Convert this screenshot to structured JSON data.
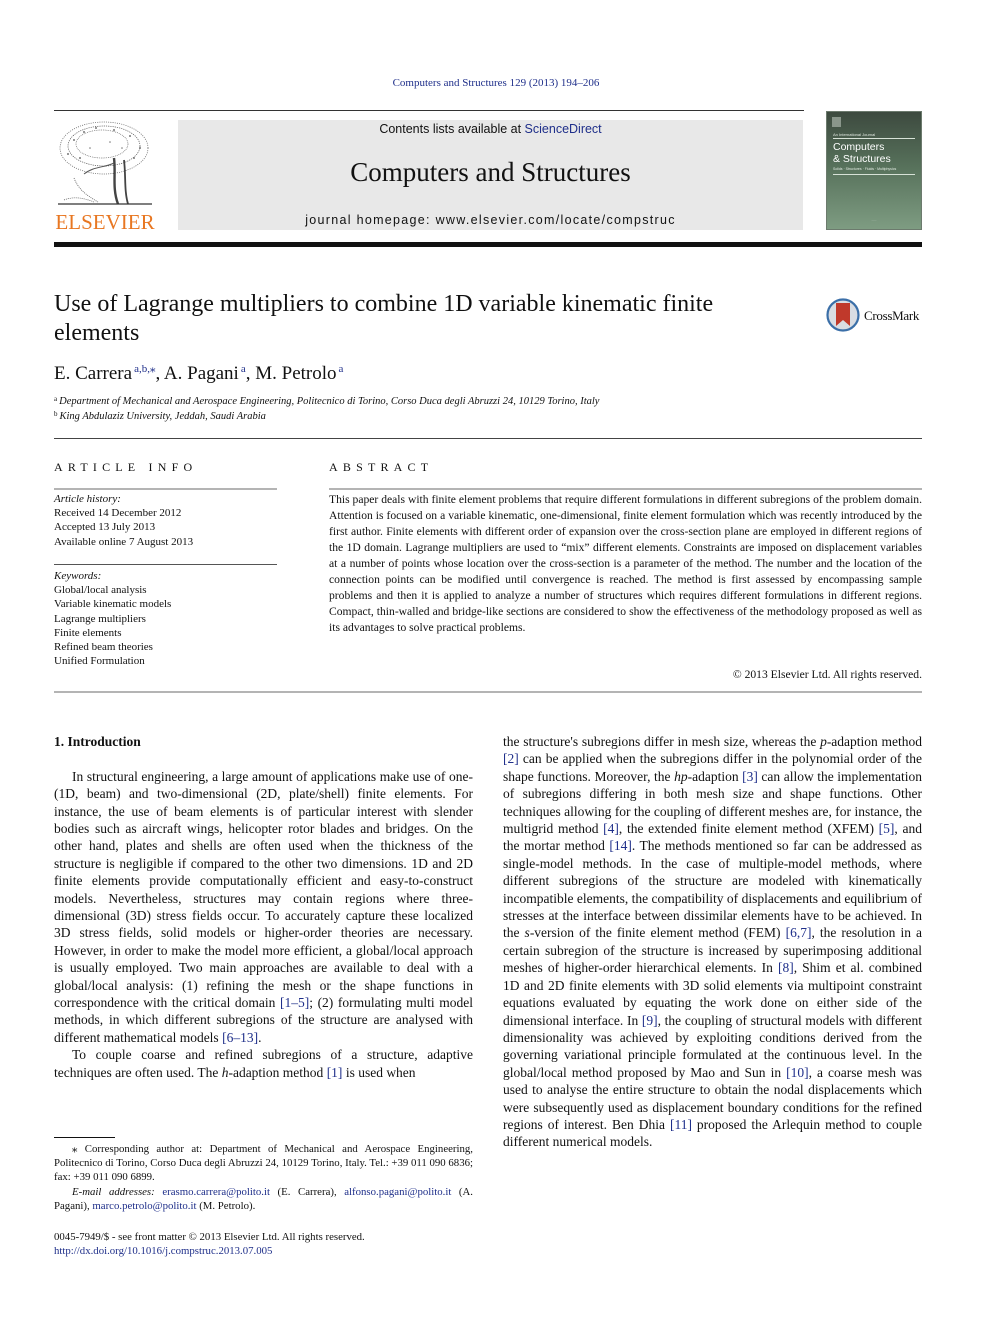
{
  "running_head": "Computers and Structures 129 (2013) 194–206",
  "publisher": {
    "name": "ELSEVIER",
    "brand_color": "#e87722"
  },
  "banner": {
    "contents_prefix": "Contents lists available at ",
    "contents_link": "ScienceDirect",
    "journal_title": "Computers and Structures",
    "homepage": "journal homepage: www.elsevier.com/locate/compstruc"
  },
  "cover": {
    "kicker": "An International Journal",
    "title_line1": "Computers",
    "title_line2": "& Structures",
    "subtitle": "Solids · Structures · Fluids · Multiphysics"
  },
  "article": {
    "title": "Use of Lagrange multipliers to combine 1D variable kinematic finite elements",
    "crossmark_label": "CrossMark",
    "authors": [
      {
        "name": "E. Carrera",
        "sup": "a,b,⁎",
        "sep": ", "
      },
      {
        "name": "A. Pagani",
        "sup": "a",
        "sep": ", "
      },
      {
        "name": "M. Petrolo",
        "sup": "a",
        "sep": ""
      }
    ],
    "affiliations": [
      {
        "mark": "a",
        "text": "Department of Mechanical and Aerospace Engineering, Politecnico di Torino, Corso Duca degli Abruzzi 24, 10129 Torino, Italy"
      },
      {
        "mark": "b",
        "text": "King Abdulaziz University, Jeddah, Saudi Arabia"
      }
    ]
  },
  "article_info": {
    "heading": "ARTICLE INFO",
    "history_label": "Article history:",
    "history": [
      "Received 14 December 2012",
      "Accepted 13 July 2013",
      "Available online 7 August 2013"
    ],
    "keywords_label": "Keywords:",
    "keywords": [
      "Global/local analysis",
      "Variable kinematic models",
      "Lagrange multipliers",
      "Finite elements",
      "Refined beam theories",
      "Unified Formulation"
    ]
  },
  "abstract": {
    "heading": "ABSTRACT",
    "text": "This paper deals with finite element problems that require different formulations in different subregions of the problem domain. Attention is focused on a variable kinematic, one-dimensional, finite element formulation which was recently introduced by the first author. Finite elements with different order of expansion over the cross-section plane are employed in different regions of the 1D domain. Lagrange multipliers are used to “mix” different elements. Constraints are imposed on displacement variables at a number of points whose location over the cross-section is a parameter of the method. The number and the location of the connection points can be modified until convergence is reached. The method is first assessed by encompassing sample problems and then it is applied to analyze a number of structures which requires different formulations in different regions. Compact, thin-walled and bridge-like sections are considered to show the effectiveness of the methodology proposed as well as its advantages to solve practical problems.",
    "copyright": "© 2013 Elsevier Ltd. All rights reserved."
  },
  "body": {
    "section_heading": "1. Introduction",
    "left_paragraphs": [
      [
        {
          "t": "In structural engineering, a large amount of applications make use of one- (1D, beam) and two-dimensional (2D, plate/shell) finite elements. For instance, the use of beam elements is of particular interest with slender bodies such as aircraft wings, helicopter rotor blades and bridges. On the other hand, plates and shells are often used when the thickness of the structure is negligible if compared to the other two dimensions. 1D and 2D finite elements provide computationally efficient and easy-to-construct models. Nevertheless, structures may contain regions where three-dimensional (3D) stress fields occur. To accurately capture these localized 3D stress fields, solid models or higher-order theories are necessary. However, in order to make the model more efficient, a global/local approach is usually employed. Two main approaches are available to deal with a global/local analysis: (1) refining the mesh or the shape functions in correspondence with the critical domain "
        },
        {
          "ref": "[1–5]"
        },
        {
          "t": "; (2) formulating multi model methods, in which different subregions of the structure are analysed with different mathematical models "
        },
        {
          "ref": "[6–13]"
        },
        {
          "t": "."
        }
      ],
      [
        {
          "t": "To couple coarse and refined subregions of a structure, adaptive techniques are often used. The "
        },
        {
          "i": "h"
        },
        {
          "t": "-adaption method "
        },
        {
          "ref": "[1]"
        },
        {
          "t": " is used when"
        }
      ]
    ],
    "right_paragraphs": [
      [
        {
          "t": "the structure's subregions differ in mesh size, whereas the "
        },
        {
          "i": "p"
        },
        {
          "t": "-adaption method "
        },
        {
          "ref": "[2]"
        },
        {
          "t": " can be applied when the subregions differ in the polynomial order of the shape functions. Moreover, the "
        },
        {
          "i": "hp"
        },
        {
          "t": "-adaption "
        },
        {
          "ref": "[3]"
        },
        {
          "t": " can allow the implementation of subregions differing in both mesh size and shape functions. Other techniques allowing for the coupling of different meshes are, for instance, the multigrid method "
        },
        {
          "ref": "[4]"
        },
        {
          "t": ", the extended finite element method (XFEM) "
        },
        {
          "ref": "[5]"
        },
        {
          "t": ", and the mortar method "
        },
        {
          "ref": "[14]"
        },
        {
          "t": ". The methods mentioned so far can be addressed as single-model methods. In the case of multiple-model methods, where different subregions of the structure are modeled with kinematically incompatible elements, the compatibility of displacements and equilibrium of stresses at the interface between dissimilar elements have to be achieved. In the "
        },
        {
          "i": "s"
        },
        {
          "t": "-version of the finite element method (FEM) "
        },
        {
          "ref": "[6,7]"
        },
        {
          "t": ", the resolution in a certain subregion of the structure is increased by superimposing additional meshes of higher-order hierarchical elements. In "
        },
        {
          "ref": "[8]"
        },
        {
          "t": ", Shim et al. combined 1D and 2D finite elements with 3D solid elements via multipoint constraint equations evaluated by equating the work done on either side of the dimensional interface. In "
        },
        {
          "ref": "[9]"
        },
        {
          "t": ", the coupling of structural models with different dimensionality was achieved by exploiting conditions derived from the governing variational principle formulated at the continuous level. In the global/local method proposed by Mao and Sun in "
        },
        {
          "ref": "[10]"
        },
        {
          "t": ", a coarse mesh was used to analyse the entire structure to obtain the nodal displacements which were subsequently used as displacement boundary conditions for the refined regions of interest. Ben Dhia "
        },
        {
          "ref": "[11]"
        },
        {
          "t": " proposed the Arlequin method to couple different numerical models."
        }
      ]
    ]
  },
  "footnotes": {
    "corresponding": "⁎ Corresponding author at: Department of Mechanical and Aerospace Engineering, Politecnico di Torino, Corso Duca degli Abruzzi 24, 10129 Torino, Italy. Tel.: +39 011 090 6836; fax: +39 011 090 6899.",
    "email_label": "E-mail addresses:",
    "emails": [
      {
        "address": "erasmo.carrera@polito.it",
        "who": " (E. Carrera), "
      },
      {
        "address": "alfonso.pagani@polito.it",
        "who": " (A. Pagani), "
      },
      {
        "address": "marco.petrolo@polito.it",
        "who": " (M. Petrolo)."
      }
    ],
    "front_matter": "0045-7949/$ - see front matter © 2013 Elsevier Ltd. All rights reserved.",
    "doi": "http://dx.doi.org/10.1016/j.compstruc.2013.07.005"
  },
  "colors": {
    "link": "#1f2f8a",
    "banner_bg": "#e8e8e8",
    "rule_grey": "#b4b4b4",
    "crossmark_red": "#c0392b",
    "crossmark_ring": "#3b6fa8"
  }
}
